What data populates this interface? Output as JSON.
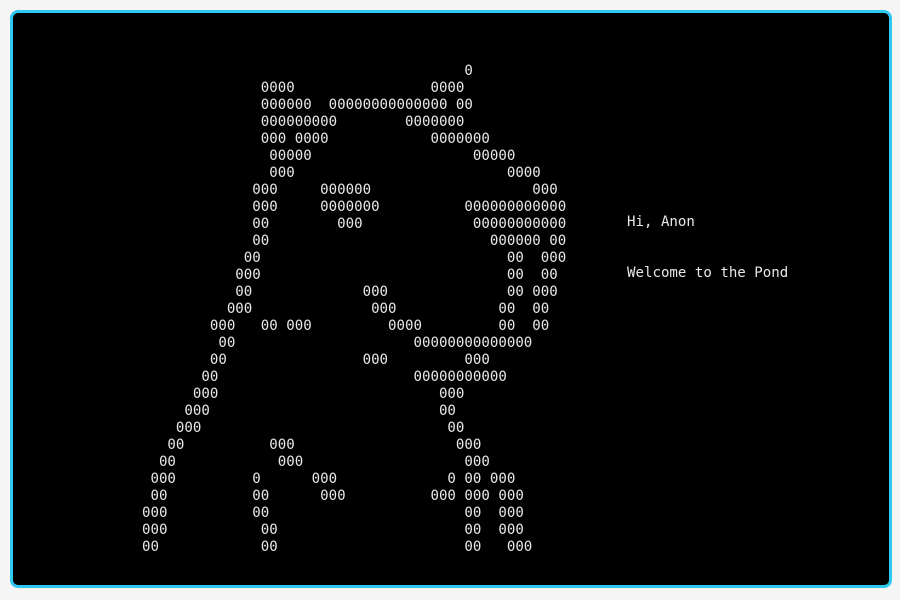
{
  "terminal": {
    "border_color": "#2ec8f0",
    "background": "#000000",
    "text_color": "#e8e8e8",
    "ascii_art": "                                        0\n                0000                0000\n                000000  00000000000000 00\n                000000000        0000000\n                000 0000            0000000\n                 00000                   00000\n                 000                         0000\n               000     000000                   000\n               000     0000000          000000000000\n               00        000             00000000000\n               00                          000000 00\n              00                             00  000\n             000                             00  00\n             00             000              00 000\n            000              000            00  00\n          000   00 000         0000         00  00\n           00                     00000000000000\n          00                000         000\n         00                       00000000000\n        000                          000\n       000                           00\n      000                             00\n     00          000                   000\n    00            000                   000\n   000         0      000             0 00 000\n   00          00      000          000 000 000\n  000          00                       00  000\n  000           00                      00  000\n  00            00                      00   000",
    "greeting": "Hi, Anon",
    "welcome": "Welcome to the Pond"
  }
}
